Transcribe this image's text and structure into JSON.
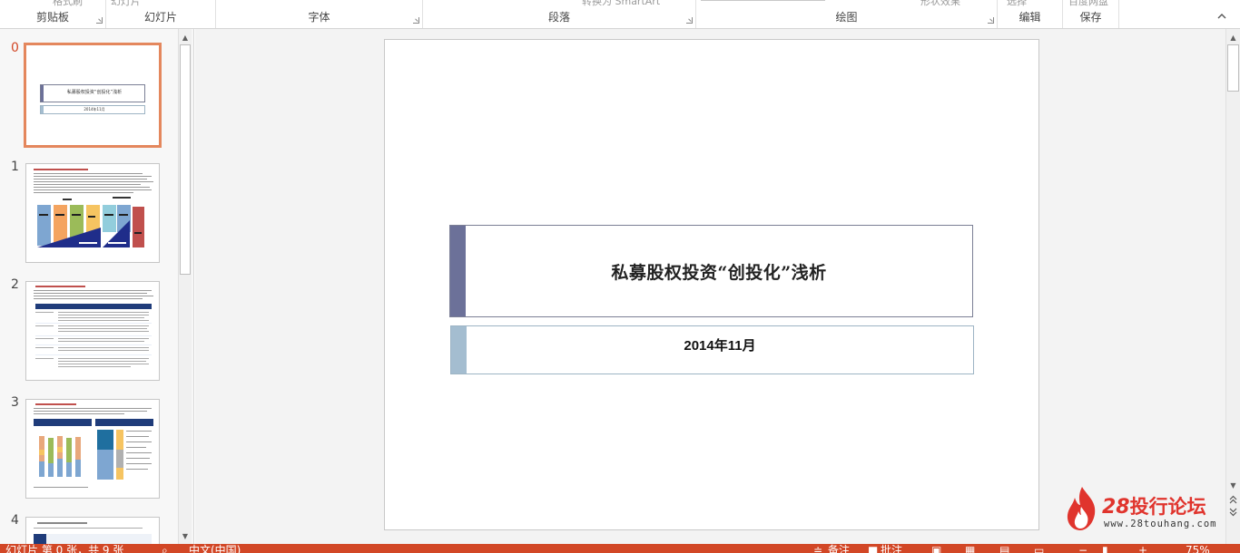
{
  "ribbon": {
    "groups": [
      {
        "label": "剪贴板",
        "top_text": "格式刷"
      },
      {
        "label": "幻灯片",
        "top_text": "幻灯片"
      },
      {
        "label": "字体"
      },
      {
        "label": "段落",
        "top_text": "转换为 SmartArt"
      },
      {
        "label": "绘图",
        "top_text": "形状效果"
      },
      {
        "label": "编辑",
        "top_text": "选择"
      },
      {
        "label": "保存",
        "top_text": "百度网盘"
      }
    ]
  },
  "thumbnails": [
    {
      "number": "0",
      "active": true,
      "title": "私募股权投资“创投化”浅析",
      "subtitle": "2014年11月"
    },
    {
      "number": "1",
      "active": false
    },
    {
      "number": "2",
      "active": false
    },
    {
      "number": "3",
      "active": false
    },
    {
      "number": "4",
      "active": false
    }
  ],
  "slide": {
    "title": "私募股权投资“创投化”浅析",
    "date": "2014年11月"
  },
  "watermark": {
    "number": "28",
    "name": "投行论坛",
    "url": "www.28touhang.com"
  },
  "statusbar": {
    "slide_info": "幻灯片 第 0 张，共 9 张",
    "language": "中文(中国)",
    "notes": "备注",
    "comments": "批注",
    "zoom": "75%"
  },
  "colors": {
    "accent": "#d24726",
    "title_bar": "#6c7199",
    "date_bar": "#a4bdd0"
  }
}
